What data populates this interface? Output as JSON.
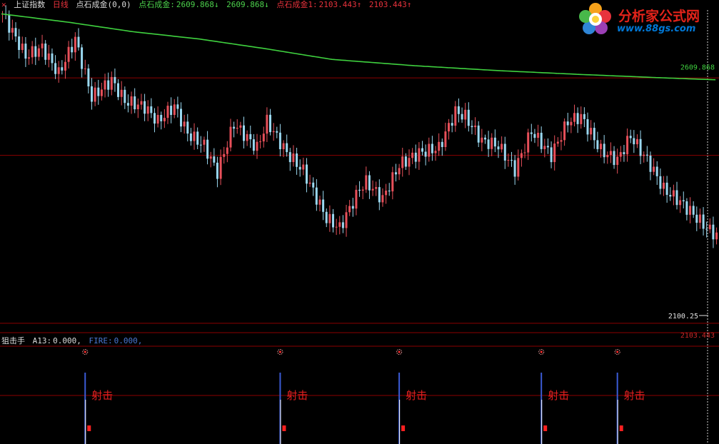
{
  "header": {
    "symbol": "上证指数",
    "period": "日线",
    "indicator": "点石成金(0,0)",
    "fields": [
      {
        "label": "点石成金:",
        "value": "2609.868↓",
        "color": "#4cd24c"
      },
      {
        "label": "",
        "value": "2609.868↓",
        "color": "#4cd24c"
      },
      {
        "label": "点石成金1:",
        "value": "2103.443↑",
        "color": "#e8323c"
      },
      {
        "label": "",
        "value": "2103.443↑",
        "color": "#e8323c"
      }
    ]
  },
  "sub_header": {
    "name": "狙击手",
    "fields": [
      {
        "label": "A13:",
        "value": "0.000,",
        "color": "#dcdcdc"
      },
      {
        "label": "FIRE:",
        "value": "0.000,",
        "color": "#4a78d4"
      }
    ]
  },
  "logo": {
    "title": "分析家公式网",
    "url": "www.88gs.com"
  },
  "colors": {
    "background": "#000000",
    "up": "#e8505a",
    "down": "#9ad8f0",
    "ma": "#3fd13f",
    "grid": "#8b0000",
    "signal_text": "#e02020",
    "signal_line": "#3b5bd6"
  },
  "chart_data": [
    {
      "type": "line",
      "title": "上证指数 日线",
      "y_range": [
        2090,
        2750
      ],
      "grid_levels": [
        2450,
        2609.868,
        2103.443
      ],
      "ma_series": {
        "name": "点石成金",
        "x": [
          0,
          20,
          40,
          60,
          80,
          100,
          125,
          150,
          175,
          200,
          216
        ],
        "values": [
          2742,
          2725,
          2705,
          2690,
          2670,
          2648,
          2635,
          2625,
          2617,
          2610,
          2606
        ]
      },
      "close_series": {
        "x": [
          0,
          7,
          12,
          17,
          22,
          27,
          33,
          37,
          43,
          47,
          52,
          56,
          61,
          65,
          70,
          77,
          80,
          86,
          91,
          98,
          102,
          108,
          110,
          115,
          120,
          126,
          132,
          137,
          140,
          145,
          150,
          155,
          160,
          166,
          171,
          175,
          181,
          186,
          190,
          196,
          200,
          204,
          208,
          213,
          216
        ],
        "values": [
          2742,
          2655,
          2672,
          2618,
          2690,
          2570,
          2605,
          2562,
          2550,
          2520,
          2552,
          2495,
          2470,
          2415,
          2515,
          2465,
          2520,
          2455,
          2418,
          2320,
          2300,
          2380,
          2395,
          2360,
          2430,
          2455,
          2465,
          2540,
          2530,
          2480,
          2470,
          2420,
          2500,
          2450,
          2520,
          2530,
          2460,
          2440,
          2490,
          2430,
          2380,
          2360,
          2335,
          2300,
          2285
        ]
      },
      "price_labels": {
        "last": "2100.25",
        "ma_value": "2609.868",
        "bottom_value": "2103.443"
      }
    },
    {
      "type": "bar",
      "title": "狙击手",
      "signal_label": "射击",
      "signal_x": [
        25,
        84,
        120,
        163,
        186
      ]
    }
  ]
}
